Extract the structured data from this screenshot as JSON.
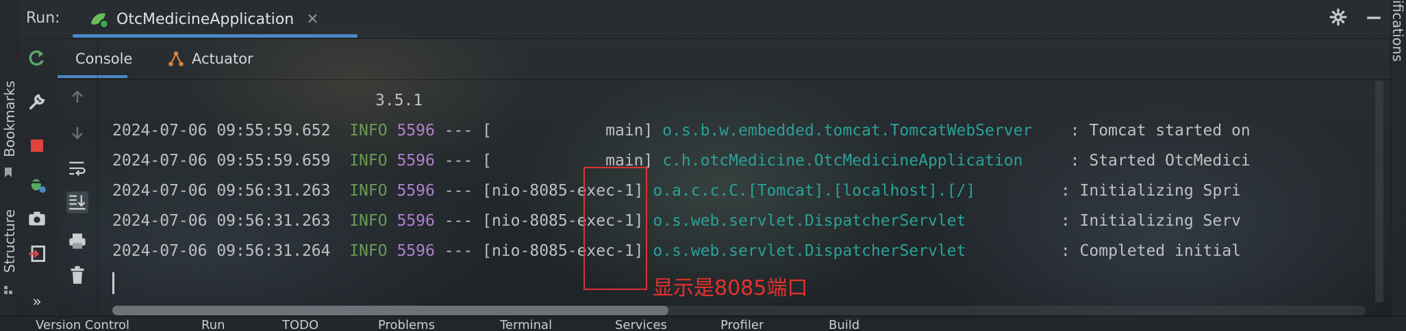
{
  "run_bar": {
    "label": "Run:",
    "tab_name": "OtcMedicineApplication",
    "close_glyph": "✕"
  },
  "left_strip": {
    "bookmarks_label": "Bookmarks",
    "structure_label": "Structure",
    "expand_glyph": "»"
  },
  "right_strip": {
    "label": "ifications"
  },
  "console_tabs": [
    {
      "label": "Console"
    },
    {
      "label": "Actuator"
    }
  ],
  "console": {
    "version_line": "3.5.1",
    "log_lines": [
      {
        "timestamp": "2024-07-06 09:55:59.652",
        "level": "INFO",
        "pid": "5596",
        "sep": "---",
        "thread": "[            main]",
        "logger": "o.s.b.w.embedded.tomcat.TomcatWebServer",
        "message": ": Tomcat started on"
      },
      {
        "timestamp": "2024-07-06 09:55:59.659",
        "level": "INFO",
        "pid": "5596",
        "sep": "---",
        "thread": "[            main]",
        "logger": "c.h.otcMedicine.OtcMedicineApplication",
        "message": ": Started OtcMedici"
      },
      {
        "timestamp": "2024-07-06 09:56:31.263",
        "level": "INFO",
        "pid": "5596",
        "sep": "---",
        "thread": "[nio-8085-exec-1]",
        "logger": "o.a.c.c.C.[Tomcat].[localhost].[/]",
        "message": ": Initializing Spri"
      },
      {
        "timestamp": "2024-07-06 09:56:31.263",
        "level": "INFO",
        "pid": "5596",
        "sep": "---",
        "thread": "[nio-8085-exec-1]",
        "logger": "o.s.web.servlet.DispatcherServlet",
        "message": ": Initializing Serv"
      },
      {
        "timestamp": "2024-07-06 09:56:31.264",
        "level": "INFO",
        "pid": "5596",
        "sep": "---",
        "thread": "[nio-8085-exec-1]",
        "logger": "o.s.web.servlet.DispatcherServlet",
        "message": ": Completed initial"
      }
    ]
  },
  "annotation": {
    "text": "显示是8085端口",
    "color": "#e8302b"
  },
  "bottom_bar": {
    "items": [
      "Version Control",
      "Run",
      "TODO",
      "Problems",
      "Terminal",
      "Services",
      "Profiler",
      "Build"
    ]
  },
  "colors": {
    "accent": "#4a88c7",
    "info": "#6a9955",
    "pid": "#b07fd1",
    "logger": "#2aa198"
  }
}
